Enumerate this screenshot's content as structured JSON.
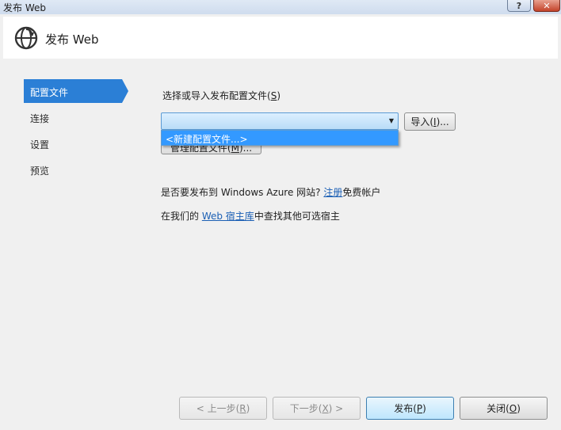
{
  "window": {
    "title": "发布 Web",
    "help_label": "?",
    "close_label": "✕"
  },
  "header": {
    "icon": "globe-publish-icon",
    "title": "发布 Web"
  },
  "nav": {
    "items": [
      {
        "label": "配置文件",
        "active": true
      },
      {
        "label": "连接",
        "active": false
      },
      {
        "label": "设置",
        "active": false
      },
      {
        "label": "预览",
        "active": false
      }
    ]
  },
  "profile": {
    "select_label": "选择或导入发布配置文件",
    "select_hotkey": "S",
    "combo_value": "",
    "dropdown_option": "<新建配置文件...>",
    "import_button": "导入",
    "import_hotkey": "I",
    "manage_button": "管理配置文件",
    "manage_hotkey": "M"
  },
  "azure": {
    "text_before": "是否要发布到 Windows Azure 网站? ",
    "link": "注册",
    "text_after": "免费帐户"
  },
  "hosts": {
    "text_before": "在我们的 ",
    "link": "Web 宿主库",
    "text_after": "中查找其他可选宿主"
  },
  "footer": {
    "prev": {
      "text": "< 上一步(",
      "hotkey": "R",
      "end": ")"
    },
    "next": {
      "text": "下一步(",
      "hotkey": "X",
      "end": ") >"
    },
    "publish": {
      "text": "发布(",
      "hotkey": "P",
      "end": ")"
    },
    "close": {
      "text": "关闭(",
      "hotkey": "O",
      "end": ")"
    }
  },
  "colors": {
    "accent": "#2b7fd6",
    "link": "#1b5fb4",
    "selection": "#3399ff"
  }
}
